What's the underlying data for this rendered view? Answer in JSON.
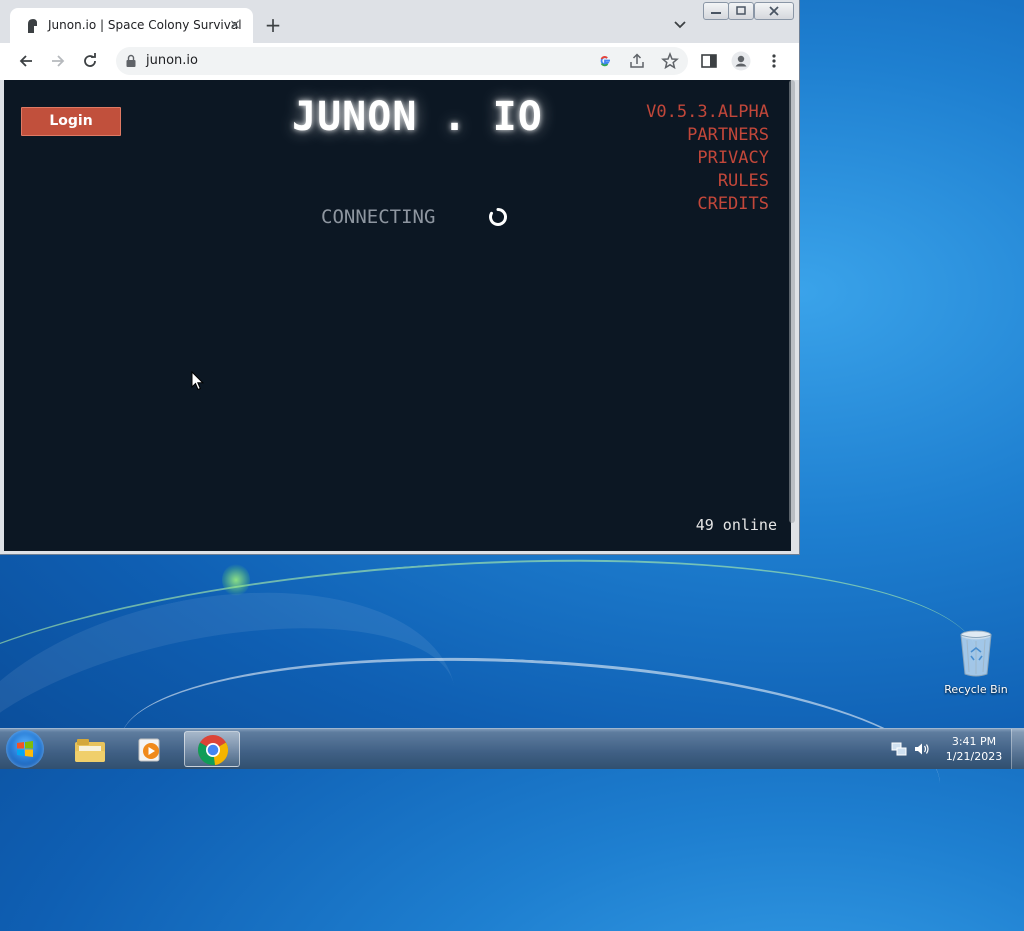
{
  "browser": {
    "tab_title": "Junon.io | Space Colony Survival",
    "url": "junon.io",
    "tab_close_symbol": "×",
    "new_tab_symbol": "+"
  },
  "page": {
    "login_label": "Login",
    "logo": "JUNON . IO",
    "links": [
      "V0.5.3.ALPHA",
      "PARTNERS",
      "PRIVACY",
      "RULES",
      "CREDITS"
    ],
    "status": "CONNECTING",
    "online": "49 online",
    "colors": {
      "background": "#0c1723",
      "accent": "#c2473a",
      "button": "#c1503c"
    }
  },
  "desktop": {
    "recycle_bin_label": "Recycle Bin"
  },
  "taskbar": {
    "time": "3:41 PM",
    "date": "1/21/2023",
    "apps": [
      "windows-explorer-icon",
      "media-player-icon",
      "chrome-icon"
    ]
  }
}
